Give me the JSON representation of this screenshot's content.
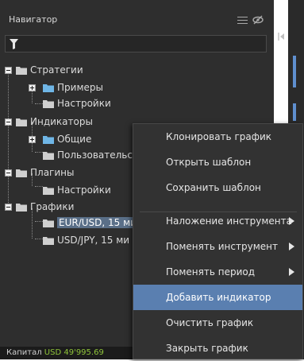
{
  "navigator": {
    "title": "Навигатор",
    "header_icons": [
      "menu-icon",
      "eye-slash-icon"
    ],
    "filter_icon": "filter-icon",
    "tree": [
      {
        "label": "Стратегии",
        "expander": "minus",
        "folder_color": "#cfcfcf"
      },
      {
        "label": "Примеры",
        "expander": "plus",
        "folder_color": "#6fb6e6"
      },
      {
        "label": "Настройки",
        "folder_color": "#cfcfcf"
      },
      {
        "label": "Индикаторы",
        "expander": "minus",
        "folder_color": "#cfcfcf"
      },
      {
        "label": "Общие",
        "expander": "plus",
        "folder_color": "#6fb6e6"
      },
      {
        "label": "Пользовательс",
        "folder_color": "#cfcfcf"
      },
      {
        "label": "Плагины",
        "expander": "minus",
        "folder_color": "#cfcfcf"
      },
      {
        "label": "Настройки",
        "folder_color": "#cfcfcf"
      },
      {
        "label": "Графики",
        "expander": "minus",
        "folder_color": "#cfcfcf"
      },
      {
        "label": "EUR/USD, 15 ми",
        "selected": true,
        "folder_color": "#cfcfcf"
      },
      {
        "label": "USD/JPY, 15 ми",
        "folder_color": "#cfcfcf"
      }
    ]
  },
  "status_bar": {
    "label": "Капитал",
    "value": "USD 49'995.69"
  },
  "context_menu": {
    "items": [
      {
        "label": "Клонировать график"
      },
      {
        "label": "Открыть шаблон"
      },
      {
        "label": "Сохранить шаблон"
      },
      {
        "label": "Наложение инструмента",
        "submenu": true
      },
      {
        "label": "Поменять инструмент",
        "submenu": true
      },
      {
        "label": "Поменять период",
        "submenu": true
      },
      {
        "label": "Добавить индикатор",
        "active": true
      },
      {
        "label": "Очистить график"
      },
      {
        "label": "Закрыть график"
      }
    ]
  },
  "colors": {
    "panel_bg": "#2e2e2e",
    "menu_bg": "#323232",
    "menu_highlight": "#5a7fb0",
    "selection": "#5a6f88",
    "status_value": "#8fc43a"
  }
}
